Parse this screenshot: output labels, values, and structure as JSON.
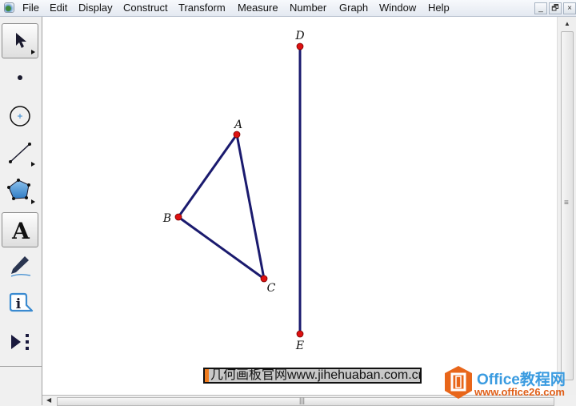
{
  "menubar": {
    "items": [
      "File",
      "Edit",
      "Display",
      "Construct",
      "Transform",
      "Measure",
      "Number",
      "Graph",
      "Window",
      "Help"
    ],
    "window_buttons": {
      "minimize": "_",
      "restore": "🗗",
      "close": "×"
    }
  },
  "toolbox": {
    "tools": [
      {
        "name": "arrow-tool",
        "active": false
      },
      {
        "name": "point-tool",
        "active": false
      },
      {
        "name": "compass-tool",
        "active": false
      },
      {
        "name": "straightedge-tool",
        "active": false
      },
      {
        "name": "polygon-tool",
        "active": false
      },
      {
        "name": "text-tool",
        "label": "A",
        "active": true
      },
      {
        "name": "marker-tool",
        "active": false
      },
      {
        "name": "information-tool",
        "label": "i",
        "active": false
      },
      {
        "name": "custom-tool",
        "active": false
      }
    ]
  },
  "sketch": {
    "points": [
      {
        "label": "A"
      },
      {
        "label": "B"
      },
      {
        "label": "C"
      },
      {
        "label": "D"
      },
      {
        "label": "E"
      }
    ],
    "segments": [
      "AB",
      "AC",
      "BC",
      "DE"
    ],
    "line_color": "#1a1a6e",
    "point_color": "#dd1111"
  },
  "caption": {
    "text": "几何画板官网www.jihehuaban.com.cn"
  },
  "watermark": {
    "title": "Office教程网",
    "url": "www.office26.com"
  },
  "scrollbars": {
    "vertical_grip": "≡",
    "horizontal_grip": "|||"
  }
}
